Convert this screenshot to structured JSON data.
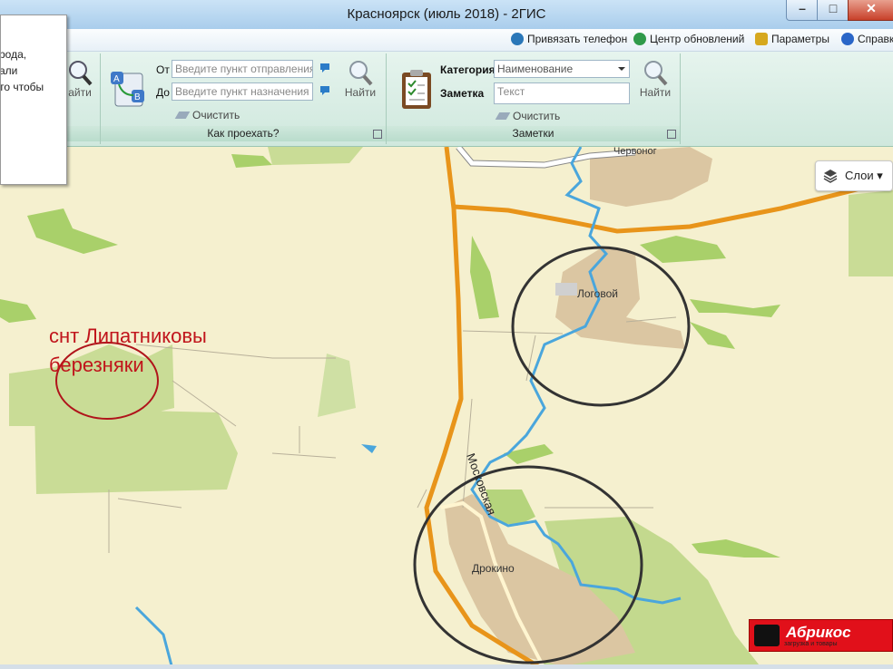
{
  "window": {
    "title": "Красноярск (июль 2018) - 2ГИС"
  },
  "topbar": {
    "bind_phone": "Привязать телефон",
    "updates": "Центр обновлений",
    "params": "Параметры",
    "help": "Справка"
  },
  "tooltip": {
    "lines": [
      "рода,",
      "али",
      "то чтобы"
    ]
  },
  "ribbon": {
    "search_find": "айти",
    "route": {
      "from_label": "От",
      "to_label": "До",
      "from_placeholder": "Введите пункт отправления",
      "to_placeholder": "Введите пункт назначения",
      "clear": "Очистить",
      "find": "Найти",
      "group_label": "Как проехать?"
    },
    "notes": {
      "category_label": "Категория",
      "note_label": "Заметка",
      "category_value": "Наименование",
      "note_placeholder": "Текст",
      "clear": "Очистить",
      "find": "Найти",
      "group_label": "Заметки"
    }
  },
  "map": {
    "layers": "Слои",
    "places": {
      "logovoy": "Логовой",
      "drokino": "Дрокино",
      "cherv": "Червоног"
    },
    "street": "Московская",
    "annotation": {
      "line1": "снт Липатниковы",
      "line2": "березняки"
    }
  },
  "banner": {
    "title": "Абрикос",
    "subtitle": "загрузка и товары"
  },
  "colors": {
    "road": "#e8941a",
    "river": "#4aa6dc",
    "forest": "#b9d88a",
    "land": "#f5f0cf",
    "annotation": "#c0141b"
  }
}
